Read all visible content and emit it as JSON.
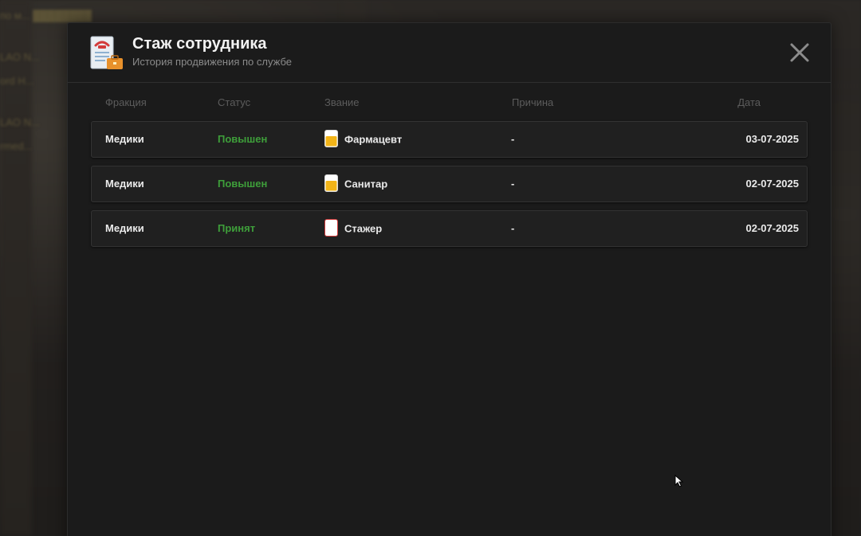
{
  "modal": {
    "title": "Стаж сотрудника",
    "subtitle": "История продвижения по службе",
    "header_icon": "employee-document-icon",
    "close_icon": "close-icon"
  },
  "columns": {
    "faction": "Фракция",
    "status": "Статус",
    "rank": "Звание",
    "reason": "Причина",
    "date": "Дата"
  },
  "rows": [
    {
      "faction": "Медики",
      "status": "Повышен",
      "rank": "Фармацевт",
      "rank_icon": "rank-badge-gold-icon",
      "reason": "-",
      "date": "03-07-2025"
    },
    {
      "faction": "Медики",
      "status": "Повышен",
      "rank": "Санитар",
      "rank_icon": "rank-badge-gold-icon",
      "reason": "-",
      "date": "02-07-2025"
    },
    {
      "faction": "Медики",
      "status": "Принят",
      "rank": "Стажер",
      "rank_icon": "rank-badge-empty-icon",
      "reason": "-",
      "date": "02-07-2025"
    }
  ],
  "colors": {
    "status_green": "#3e9e3a",
    "badge_gold": "#f2b418",
    "modal_bg": "#1b1b1b"
  }
}
